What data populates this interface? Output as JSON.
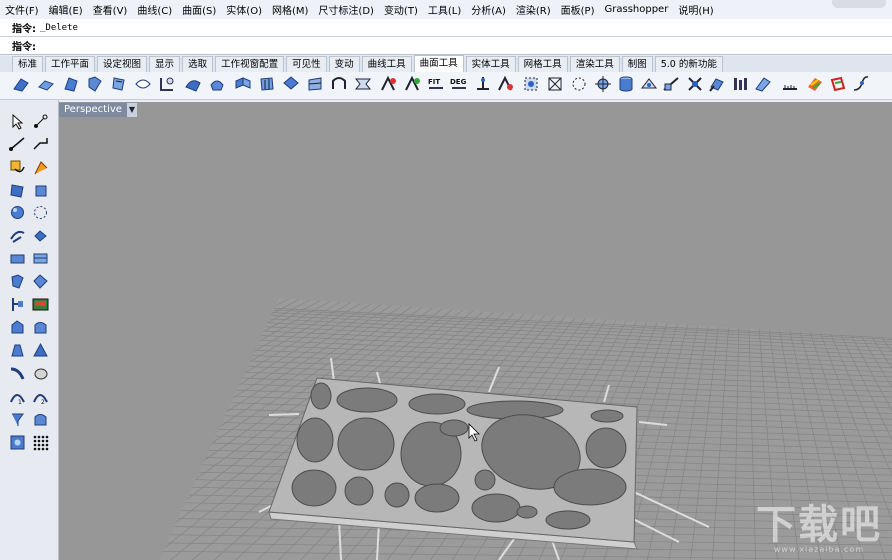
{
  "menu": [
    "文件(F)",
    "编辑(E)",
    "查看(V)",
    "曲线(C)",
    "曲面(S)",
    "实体(O)",
    "网格(M)",
    "尺寸标注(D)",
    "变动(T)",
    "工具(L)",
    "分析(A)",
    "渲染(R)",
    "面板(P)",
    "Grasshopper",
    "说明(H)"
  ],
  "command": {
    "history_label": "指令:",
    "history_value": "_Delete",
    "prompt_label": "指令:",
    "prompt_value": ""
  },
  "tabs": [
    "标准",
    "工作平面",
    "设定视图",
    "显示",
    "选取",
    "工作视窗配置",
    "可见性",
    "变动",
    "曲线工具",
    "曲面工具",
    "实体工具",
    "网格工具",
    "渲染工具",
    "制图",
    "5.0 的新功能"
  ],
  "active_tab": "曲面工具",
  "toolbar_text_icons": {
    "fit": "FIT",
    "deg": "DEG"
  },
  "viewport": {
    "title": "Perspective"
  },
  "watermark": {
    "big": "下载吧",
    "small": "www.xiazaiba.com"
  }
}
